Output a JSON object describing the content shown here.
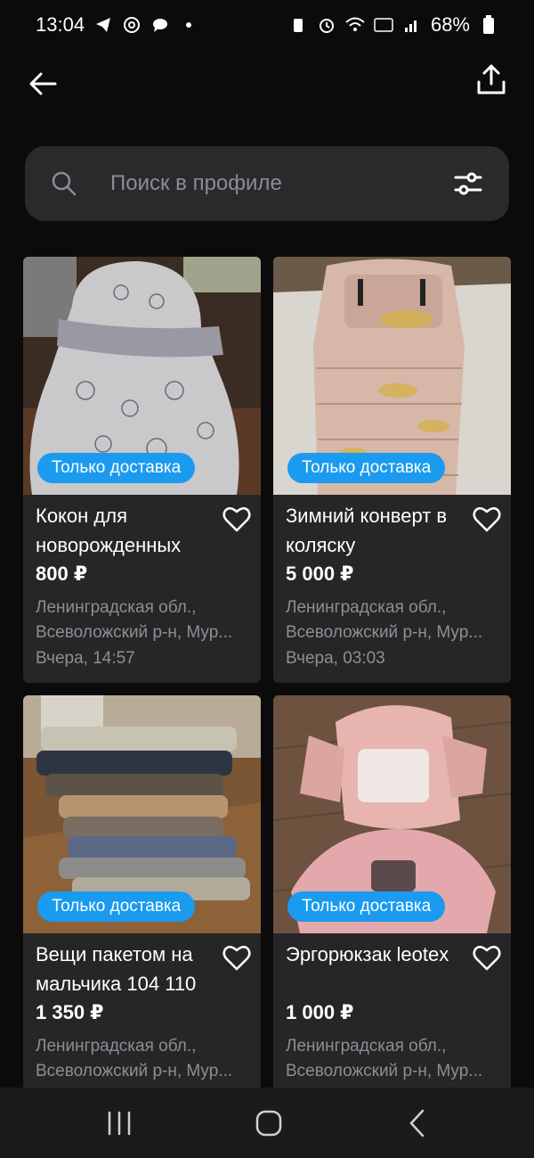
{
  "status": {
    "time": "13:04",
    "battery": "68%",
    "left_icons": [
      "telegram-icon",
      "at-icon",
      "chat-icon",
      "dot-icon"
    ],
    "right_icons": [
      "battery-saver-icon",
      "alarm-icon",
      "wifi-icon",
      "volte-icon",
      "signal-icon",
      "battery-icon"
    ]
  },
  "search": {
    "placeholder": "Поиск в профиле"
  },
  "items": [
    {
      "badge": "Только доставка",
      "title": "Кокон для новорожденных",
      "price": "800 ₽",
      "location_line1": "Ленинградская обл.,",
      "location_line2": "Всеволожский р-н, Мур...",
      "date": "Вчера, 14:57"
    },
    {
      "badge": "Только доставка",
      "title": "Зимний конверт в коляску",
      "price": "5 000 ₽",
      "location_line1": "Ленинградская обл.,",
      "location_line2": "Всеволожский р-н, Мур...",
      "date": "Вчера, 03:03"
    },
    {
      "badge": "Только доставка",
      "title": "Вещи пакетом на мальчика 104 110",
      "price": "1 350 ₽",
      "location_line1": "Ленинградская обл.,",
      "location_line2": "Всеволожский р-н, Мур...",
      "date": ""
    },
    {
      "badge": "Только доставка",
      "title": "Эргорюкзак leotex",
      "price": "1 000 ₽",
      "location_line1": "Ленинградская обл.,",
      "location_line2": "Всеволожский р-н, Мур...",
      "date": ""
    }
  ],
  "colors": {
    "accent": "#1a9bf0",
    "card": "#262628",
    "background": "#0b0b0b",
    "muted_text": "#8e8e93"
  }
}
